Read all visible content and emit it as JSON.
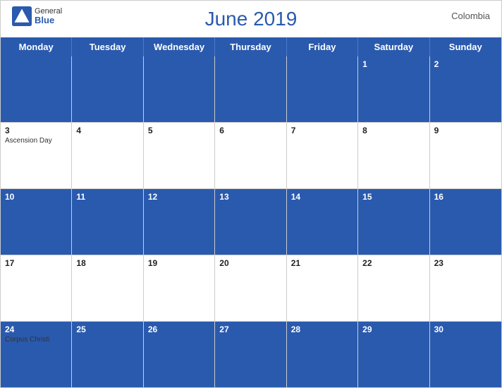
{
  "header": {
    "title": "June 2019",
    "country": "Colombia",
    "logo_general": "General",
    "logo_blue": "Blue"
  },
  "days": [
    "Monday",
    "Tuesday",
    "Wednesday",
    "Thursday",
    "Friday",
    "Saturday",
    "Sunday"
  ],
  "weeks": [
    {
      "blue": true,
      "cells": [
        {
          "date": "",
          "event": ""
        },
        {
          "date": "",
          "event": ""
        },
        {
          "date": "",
          "event": ""
        },
        {
          "date": "",
          "event": ""
        },
        {
          "date": "",
          "event": ""
        },
        {
          "date": "1",
          "event": ""
        },
        {
          "date": "2",
          "event": ""
        }
      ]
    },
    {
      "blue": false,
      "cells": [
        {
          "date": "3",
          "event": "Ascension Day"
        },
        {
          "date": "4",
          "event": ""
        },
        {
          "date": "5",
          "event": ""
        },
        {
          "date": "6",
          "event": ""
        },
        {
          "date": "7",
          "event": ""
        },
        {
          "date": "8",
          "event": ""
        },
        {
          "date": "9",
          "event": ""
        }
      ]
    },
    {
      "blue": true,
      "cells": [
        {
          "date": "10",
          "event": ""
        },
        {
          "date": "11",
          "event": ""
        },
        {
          "date": "12",
          "event": ""
        },
        {
          "date": "13",
          "event": ""
        },
        {
          "date": "14",
          "event": ""
        },
        {
          "date": "15",
          "event": ""
        },
        {
          "date": "16",
          "event": ""
        }
      ]
    },
    {
      "blue": false,
      "cells": [
        {
          "date": "17",
          "event": ""
        },
        {
          "date": "18",
          "event": ""
        },
        {
          "date": "19",
          "event": ""
        },
        {
          "date": "20",
          "event": ""
        },
        {
          "date": "21",
          "event": ""
        },
        {
          "date": "22",
          "event": ""
        },
        {
          "date": "23",
          "event": ""
        }
      ]
    },
    {
      "blue": true,
      "cells": [
        {
          "date": "24",
          "event": "Corpus Christi"
        },
        {
          "date": "25",
          "event": ""
        },
        {
          "date": "26",
          "event": ""
        },
        {
          "date": "27",
          "event": ""
        },
        {
          "date": "28",
          "event": ""
        },
        {
          "date": "29",
          "event": ""
        },
        {
          "date": "30",
          "event": ""
        }
      ]
    }
  ]
}
